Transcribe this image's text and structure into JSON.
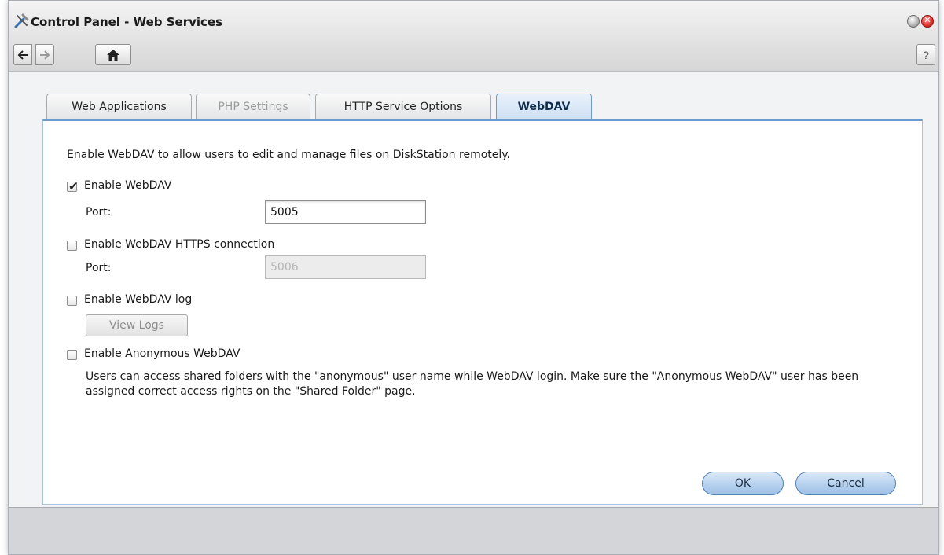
{
  "window": {
    "title": "Control Panel - Web Services",
    "help_label": "?"
  },
  "tabs": [
    {
      "label": "Web Applications",
      "state": "normal"
    },
    {
      "label": "PHP Settings",
      "state": "disabled"
    },
    {
      "label": "HTTP Service Options",
      "state": "normal"
    },
    {
      "label": "WebDAV",
      "state": "active"
    }
  ],
  "webdav": {
    "intro": "Enable WebDAV to allow users to edit and manage files on DiskStation remotely.",
    "enable_webdav": {
      "label": "Enable WebDAV",
      "checked": true
    },
    "port_label": "Port:",
    "port_value": "5005",
    "enable_https": {
      "label": "Enable WebDAV HTTPS connection",
      "checked": false
    },
    "https_port_label": "Port:",
    "https_port_value": "5006",
    "enable_log": {
      "label": "Enable WebDAV log",
      "checked": false
    },
    "view_logs_label": "View Logs",
    "enable_anonymous": {
      "label": "Enable Anonymous WebDAV",
      "checked": false
    },
    "anonymous_note": "Users can access shared folders with the \"anonymous\" user name while WebDAV login. Make sure the \"Anonymous WebDAV\" user has been assigned correct access rights on the \"Shared Folder\" page."
  },
  "footer": {
    "ok_label": "OK",
    "cancel_label": "Cancel"
  },
  "icons": [
    "tools-icon",
    "minimize-icon",
    "close-icon",
    "back-arrow-icon",
    "forward-arrow-icon",
    "home-icon",
    "help-icon",
    "checkmark-icon"
  ],
  "colors": {
    "accent": "#6b9bcf",
    "close_button": "#e0312d",
    "primary_button": "#b6d1ee"
  }
}
